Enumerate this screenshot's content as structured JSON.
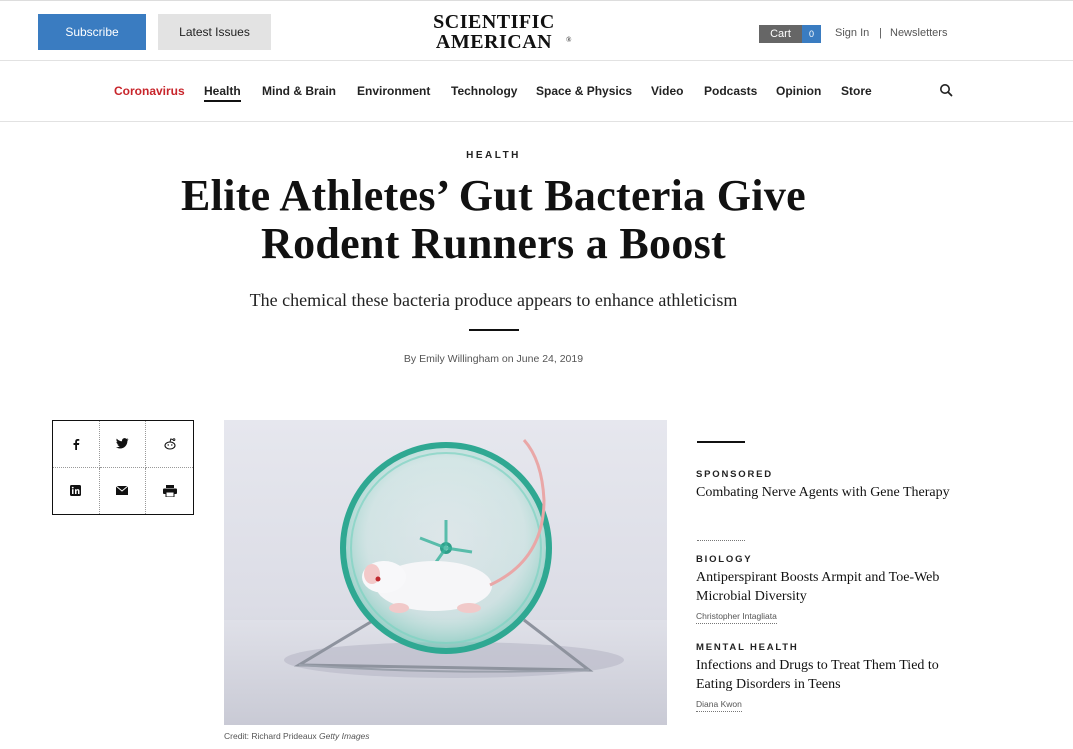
{
  "header": {
    "subscribe_label": "Subscribe",
    "latest_issues_label": "Latest Issues",
    "logo_line1": "SCIENTIFIC",
    "logo_line2": "AMERICAN",
    "cart_label": "Cart",
    "cart_count": "0",
    "sign_in_label": "Sign In",
    "separator": "|",
    "newsletters_label": "Newsletters"
  },
  "nav": {
    "items": [
      {
        "label": "Coronavirus"
      },
      {
        "label": "Health"
      },
      {
        "label": "Mind & Brain"
      },
      {
        "label": "Environment"
      },
      {
        "label": "Technology"
      },
      {
        "label": "Space & Physics"
      },
      {
        "label": "Video"
      },
      {
        "label": "Podcasts"
      },
      {
        "label": "Opinion"
      },
      {
        "label": "Store"
      }
    ],
    "search_icon": "search-icon"
  },
  "article": {
    "category": "HEALTH",
    "headline": "Elite Athletes’ Gut Bacteria Give Rodent Runners a Boost",
    "subtitle": "The chemical these bacteria produce appears to enhance athleticism",
    "byline": "By Emily Willingham on June 24, 2019",
    "image_credit": "Credit: Richard Prideaux",
    "image_credit_source": "Getty Images"
  },
  "share": {
    "icons": [
      "facebook-icon",
      "twitter-icon",
      "reddit-icon",
      "linkedin-icon",
      "email-icon",
      "print-icon"
    ]
  },
  "sidebar": {
    "items": [
      {
        "category": "SPONSORED",
        "title": "Combating Nerve Agents with Gene Therapy",
        "author": ""
      },
      {
        "category": "BIOLOGY",
        "title": "Antiperspirant Boosts Armpit and Toe-Web Microbial Diversity",
        "author": "Christopher Intagliata"
      },
      {
        "category": "MENTAL HEALTH",
        "title": "Infections and Drugs to Treat Them Tied to Eating Disorders in Teens",
        "author": "Diana Kwon"
      }
    ]
  },
  "colors": {
    "accent_blue": "#3a7cc1",
    "corona_red": "#c8252b"
  }
}
